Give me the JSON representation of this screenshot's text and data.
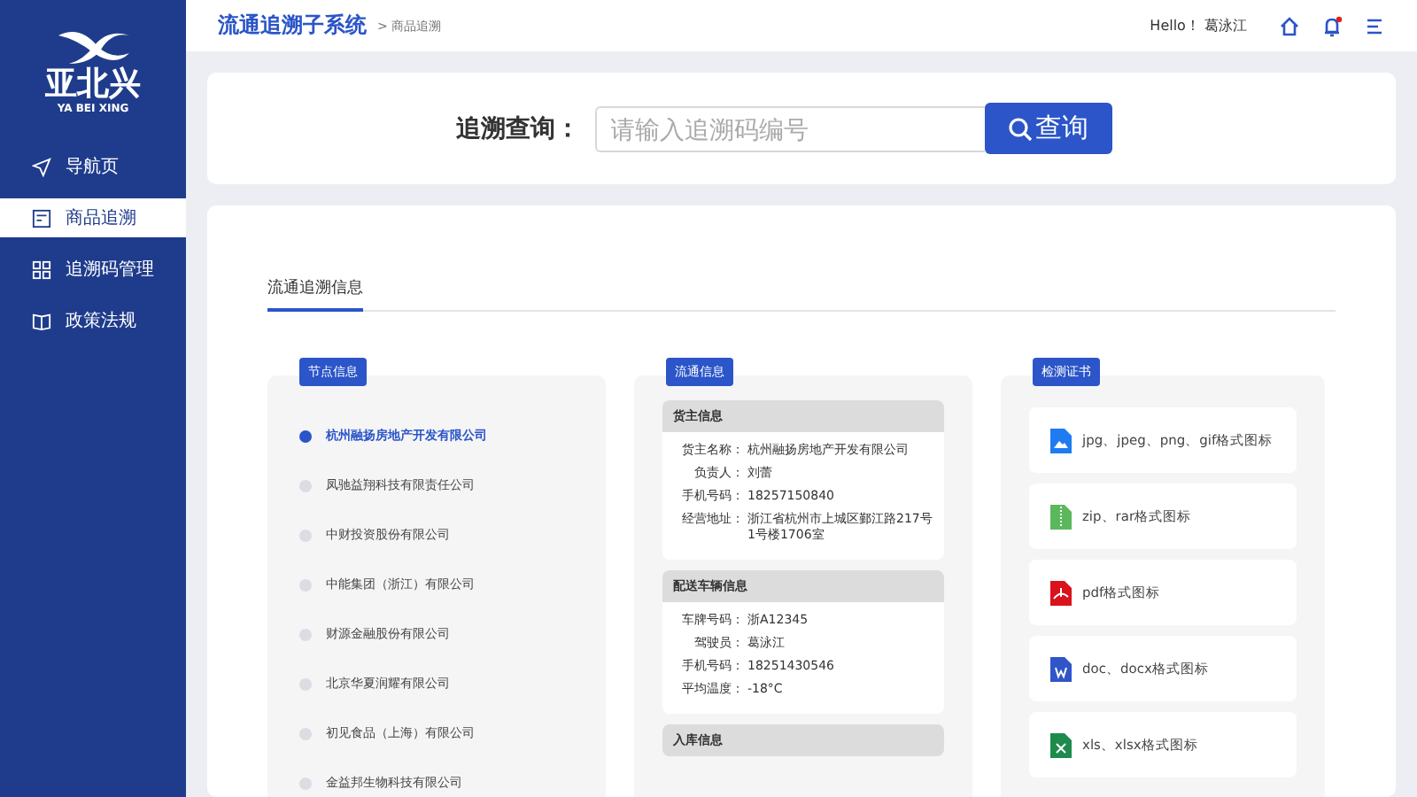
{
  "sidebar": {
    "logo_text": "亚北兴",
    "logo_subtitle": "YA BEI XING",
    "items": [
      {
        "label": "导航页",
        "kind": "navigate",
        "selected": false
      },
      {
        "label": "商品追溯",
        "kind": "goods",
        "selected": true
      },
      {
        "label": "追溯码管理",
        "kind": "qr",
        "selected": false
      },
      {
        "label": "政策法规",
        "kind": "book",
        "selected": false
      }
    ]
  },
  "header": {
    "title": "流通追溯子系统",
    "breadcrumb": "> 商品追溯",
    "greeting": "Hello！ 葛泳江",
    "notifications_unread": true
  },
  "search": {
    "label": "追溯查询：",
    "placeholder": "请输入追溯码编号",
    "button": "查询"
  },
  "section_title": "流通追溯信息",
  "nodes": {
    "tag": "节点信息",
    "items": [
      {
        "name": "杭州融扬房地产开发有限公司",
        "selected": true
      },
      {
        "name": "凤驰益翔科技有限责任公司",
        "selected": false
      },
      {
        "name": "中财投资股份有限公司",
        "selected": false
      },
      {
        "name": "中能集团（浙江）有限公司",
        "selected": false
      },
      {
        "name": "财源金融股份有限公司",
        "selected": false
      },
      {
        "name": "北京华夏润耀有限公司",
        "selected": false
      },
      {
        "name": "初见食品（上海）有限公司",
        "selected": false
      },
      {
        "name": "金益邦生物科技有限公司",
        "selected": false
      }
    ]
  },
  "flow": {
    "tag": "流通信息",
    "sections": [
      {
        "title": "货主信息",
        "fields": [
          {
            "label": "货主名称：",
            "value": "杭州融扬房地产开发有限公司"
          },
          {
            "label": "负责人：",
            "value": "刘蕾"
          },
          {
            "label": "手机号码：",
            "value": "18257150840"
          },
          {
            "label": "经营地址：",
            "value": "浙江省杭州市上城区鄞江路217号1号楼1706室"
          }
        ]
      },
      {
        "title": "配送车辆信息",
        "fields": [
          {
            "label": "车牌号码：",
            "value": "浙A12345"
          },
          {
            "label": "驾驶员：",
            "value": "葛泳江"
          },
          {
            "label": "手机号码：",
            "value": "18251430546"
          },
          {
            "label": "平均温度：",
            "value": "-18°C"
          }
        ]
      },
      {
        "title": "入库信息"
      }
    ]
  },
  "certificates": {
    "tag": "检测证书",
    "items": [
      {
        "kind": "image",
        "name": "jpg、jpeg、png、gif格式图标"
      },
      {
        "kind": "zip",
        "name": "zip、rar格式图标"
      },
      {
        "kind": "pdf",
        "name": "pdf格式图标"
      },
      {
        "kind": "word",
        "name": "doc、docx格式图标"
      },
      {
        "kind": "excel",
        "name": "xls、xlsx格式图标"
      }
    ]
  }
}
